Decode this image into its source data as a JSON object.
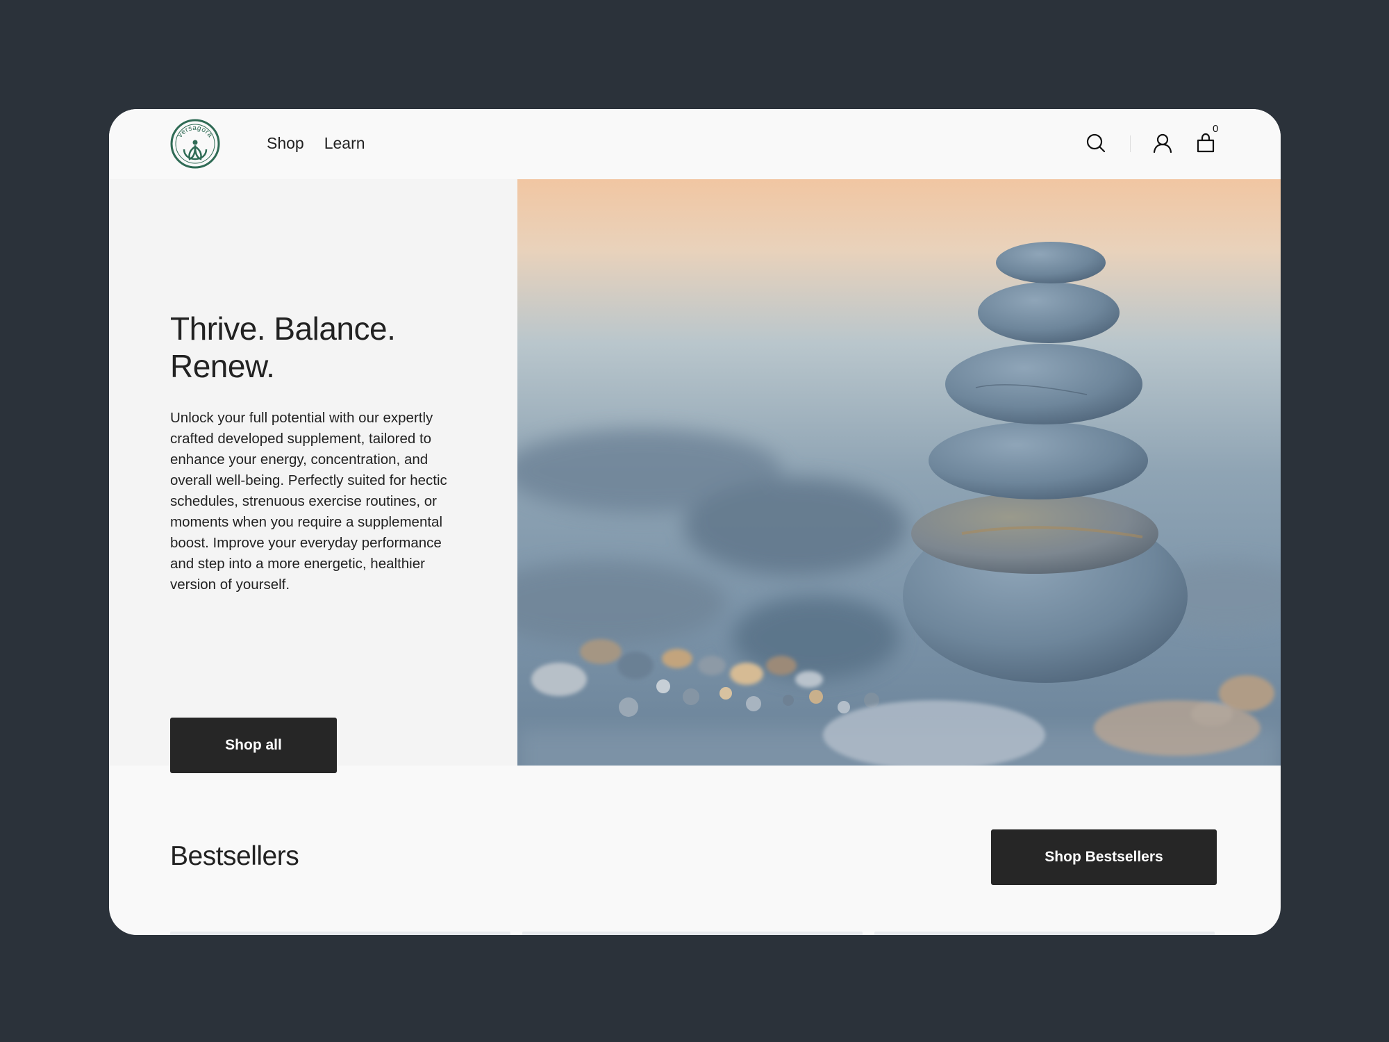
{
  "header": {
    "logo": {
      "text": "versagora",
      "icon": "leaf-person-logo"
    },
    "nav": [
      {
        "label": "Shop"
      },
      {
        "label": "Learn"
      }
    ],
    "icons": {
      "search": "search-icon",
      "account": "user-icon",
      "cart": "bag-icon"
    },
    "cart_count": "0"
  },
  "hero": {
    "title": "Thrive. Balance. Renew.",
    "text": "Unlock your full potential with our expertly crafted developed supplement, tailored to enhance your energy, concentration, and overall well-being. Perfectly suited for hectic schedules, strenuous exercise routines, or moments when you require a supplemental boost. Improve your everyday performance and step into a more energetic, healthier version of yourself.",
    "cta": "Shop all",
    "image": "stacked-stones-on-pebble-beach"
  },
  "bestsellers": {
    "title": "Bestsellers",
    "cta": "Shop Bestsellers"
  },
  "colors": {
    "background": "#2b323a",
    "window": "#f9f9f9",
    "hero_panel": "#f4f4f4",
    "button": "#262626",
    "logo": "#2f6b55"
  }
}
